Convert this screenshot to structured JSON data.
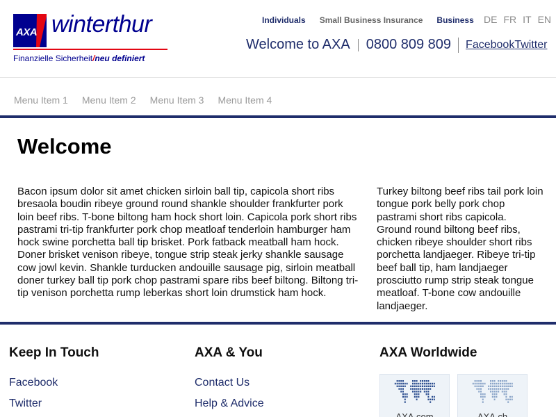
{
  "logo": {
    "mark": "AXA",
    "wordmark": "winterthur",
    "tagline_left": "Finanzielle Sicherheit",
    "tagline_slash": "/",
    "tagline_right": "neu definiert"
  },
  "top_nav": {
    "items": [
      "Individuals",
      "Small Business Insurance",
      "Business"
    ],
    "languages": [
      "DE",
      "FR",
      "IT",
      "EN"
    ]
  },
  "header": {
    "welcome": "Welcome to AXA",
    "phone": "0800 809 809",
    "facebook": "Facebook",
    "twitter": "Twitter"
  },
  "menu": {
    "items": [
      "Menu Item 1",
      "Menu Item 2",
      "Menu Item 3",
      "Menu Item 4"
    ]
  },
  "colors": {
    "brand_blue": "#00008f",
    "nav_blue": "#1f2d6b",
    "brand_red": "#e30613"
  },
  "main": {
    "title": "Welcome",
    "left_text": "Bacon ipsum dolor sit amet chicken sirloin ball tip, capicola short ribs bresaola boudin ribeye ground round shankle shoulder frankfurter pork loin beef ribs. T-bone biltong ham hock short loin. Capicola pork short ribs pastrami tri-tip frankfurter pork chop meatloaf tenderloin hamburger ham hock swine porchetta ball tip brisket. Pork fatback meatball ham hock. Doner brisket venison ribeye, tongue strip steak jerky shankle sausage cow jowl kevin. Shankle turducken andouille sausage pig, sirloin meatball doner turkey ball tip pork chop pastrami spare ribs beef biltong. Biltong tri-tip venison porchetta rump leberkas short loin drumstick ham hock.",
    "right_text": "Turkey biltong beef ribs tail pork loin tongue pork belly pork chop pastrami short ribs capicola. Ground round biltong beef ribs, chicken ribeye shoulder short ribs porchetta landjaeger. Ribeye tri-tip beef ball tip, ham landjaeger prosciutto rump strip steak tongue meatloaf. T-bone cow andouille landjaeger."
  },
  "footer": {
    "keep_in_touch": {
      "title": "Keep In Touch",
      "links": [
        "Facebook",
        "Twitter"
      ]
    },
    "axa_and_you": {
      "title": "AXA & You",
      "links": [
        "Contact Us",
        "Help & Advice"
      ]
    },
    "worldwide": {
      "title": "AXA Worldwide",
      "tiles": [
        "AXA.com",
        "AXA.ch"
      ],
      "icon": "world-map-icon"
    }
  }
}
